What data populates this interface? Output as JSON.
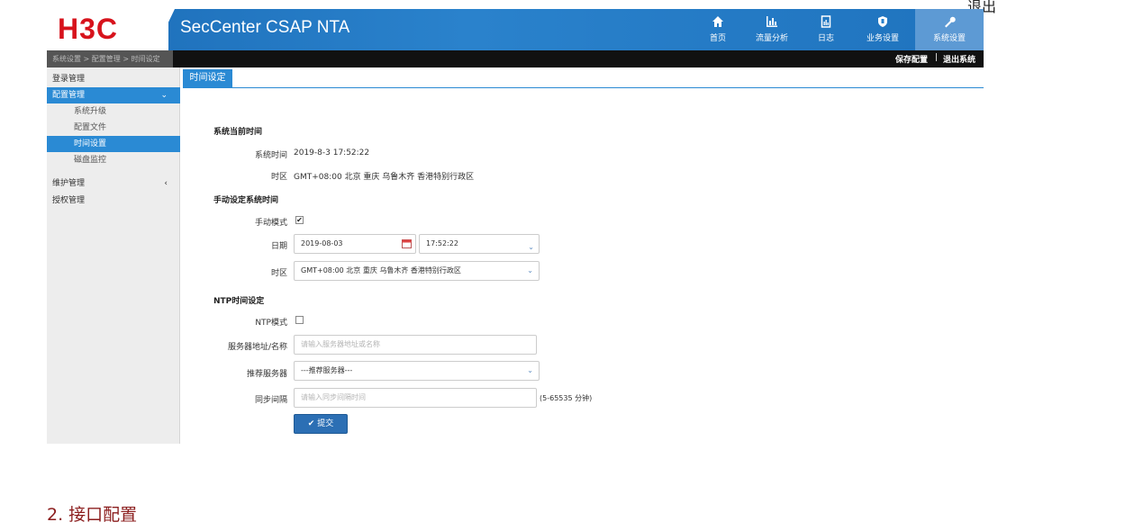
{
  "top_link": "退出",
  "header": {
    "logo": "H3C",
    "app_title": "SecCenter CSAP NTA",
    "nav": [
      {
        "label": "首页",
        "icon": "home-icon"
      },
      {
        "label": "流量分析",
        "icon": "bar-chart-icon"
      },
      {
        "label": "日志",
        "icon": "document-icon"
      },
      {
        "label": "业务设置",
        "icon": "shield-icon"
      },
      {
        "label": "系统设置",
        "icon": "wrench-icon",
        "active": true
      }
    ]
  },
  "subbar": {
    "breadcrumb": "系统设置 > 配置管理 > 时间设定",
    "save_config": "保存配置",
    "separator": "|",
    "logout": "退出系统"
  },
  "sidebar": {
    "items": [
      {
        "label": "登录管理"
      },
      {
        "label": "配置管理",
        "chevron": "⌄"
      },
      {
        "label": "系统升级"
      },
      {
        "label": "配置文件"
      },
      {
        "label": "时间设置"
      },
      {
        "label": "磁盘监控"
      },
      {
        "label": "维护管理",
        "chevron": "‹"
      },
      {
        "label": "授权管理"
      }
    ]
  },
  "main": {
    "tab": "时间设定",
    "current": {
      "heading": "系统当前时间",
      "time_label": "系统时间",
      "time_value": "2019-8-3 17:52:22",
      "tz_label": "时区",
      "tz_value": "GMT+08:00 北京 重庆 乌鲁木齐 香港特别行政区"
    },
    "manual": {
      "heading": "手动设定系统时间",
      "mode_label": "手动模式",
      "mode_checked": "✔",
      "date_label": "日期",
      "date_value": "2019-08-03",
      "time_value": "17:52:22",
      "tz_label": "时区",
      "tz_value": "GMT+08:00 北京 重庆 乌鲁木齐 香港特别行政区"
    },
    "ntp": {
      "heading": "NTP时间设定",
      "mode_label": "NTP模式",
      "server_label": "服务器地址/名称",
      "server_placeholder": "请输入服务器地址或名称",
      "recommend_label": "推荐服务器",
      "recommend_value": "---推荐服务器---",
      "interval_label": "同步间隔",
      "interval_placeholder": "请输入同步间隔时间",
      "interval_hint": "(5-65535 分钟)"
    },
    "submit": "提交"
  },
  "below": {
    "heading": "2. 接口配置"
  }
}
